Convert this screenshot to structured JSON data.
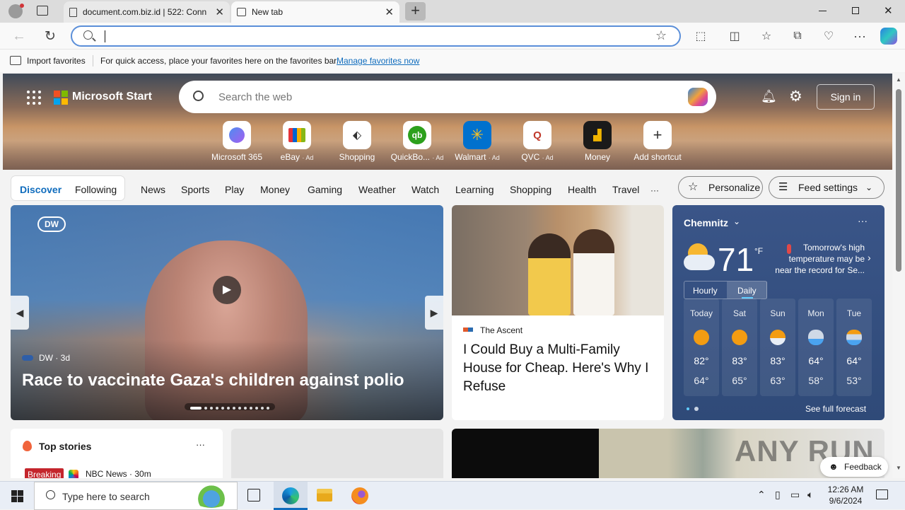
{
  "browser": {
    "tabs": [
      {
        "title": "document.com.biz.id | 522: Conn",
        "active": false
      },
      {
        "title": "New tab",
        "active": true
      }
    ],
    "address_value": "",
    "favorites_bar": {
      "import_label": "Import favorites",
      "message": "For quick access, place your favorites here on the favorites bar.",
      "manage_link": "Manage favorites now"
    }
  },
  "start": {
    "brand": "Microsoft Start",
    "search_placeholder": "Search the web",
    "sign_in": "Sign in",
    "shortcuts": [
      {
        "label": "Microsoft 365",
        "ad": ""
      },
      {
        "label": "eBay",
        "ad": "· Ad"
      },
      {
        "label": "Shopping",
        "ad": ""
      },
      {
        "label": "QuickBo...",
        "ad": "· Ad"
      },
      {
        "label": "Walmart",
        "ad": "· Ad"
      },
      {
        "label": "QVC",
        "ad": "· Ad"
      },
      {
        "label": "Money",
        "ad": ""
      },
      {
        "label": "Add shortcut",
        "ad": ""
      }
    ],
    "pill_tabs": [
      "Discover",
      "Following"
    ],
    "nav": [
      "News",
      "Sports",
      "Play",
      "Money",
      "Gaming",
      "Weather",
      "Watch",
      "Learning",
      "Shopping",
      "Health",
      "Travel"
    ],
    "more": "···",
    "personalize": "Personalize",
    "feed_settings": "Feed settings"
  },
  "feature": {
    "source": "DW",
    "age": "3d",
    "source_line": "DW · 3d",
    "logo": "DW",
    "headline": "Race to vaccinate Gaza's children against polio"
  },
  "article": {
    "source": "The Ascent",
    "headline": "I Could Buy a Multi-Family House for Cheap. Here's Why I Refuse"
  },
  "weather": {
    "city": "Chemnitz",
    "temp": "71",
    "unit": "°F",
    "note": "Tomorrow's high temperature may be near the record for Se...",
    "toggle": [
      "Hourly",
      "Daily"
    ],
    "days": [
      {
        "name": "Today",
        "high": "82°",
        "low": "64°"
      },
      {
        "name": "Sat",
        "high": "83°",
        "low": "65°"
      },
      {
        "name": "Sun",
        "high": "83°",
        "low": "63°"
      },
      {
        "name": "Mon",
        "high": "64°",
        "low": "58°"
      },
      {
        "name": "Tue",
        "high": "64°",
        "low": "53°"
      }
    ],
    "full_forecast": "See full forecast"
  },
  "top_stories": {
    "title": "Top stories",
    "badge": "Breaking",
    "source": "NBC News · 30m"
  },
  "feedback": "Feedback",
  "watermark": "ANY RUN",
  "taskbar": {
    "search_placeholder": "Type here to search",
    "time": "12:26 AM",
    "date": "9/6/2024"
  }
}
